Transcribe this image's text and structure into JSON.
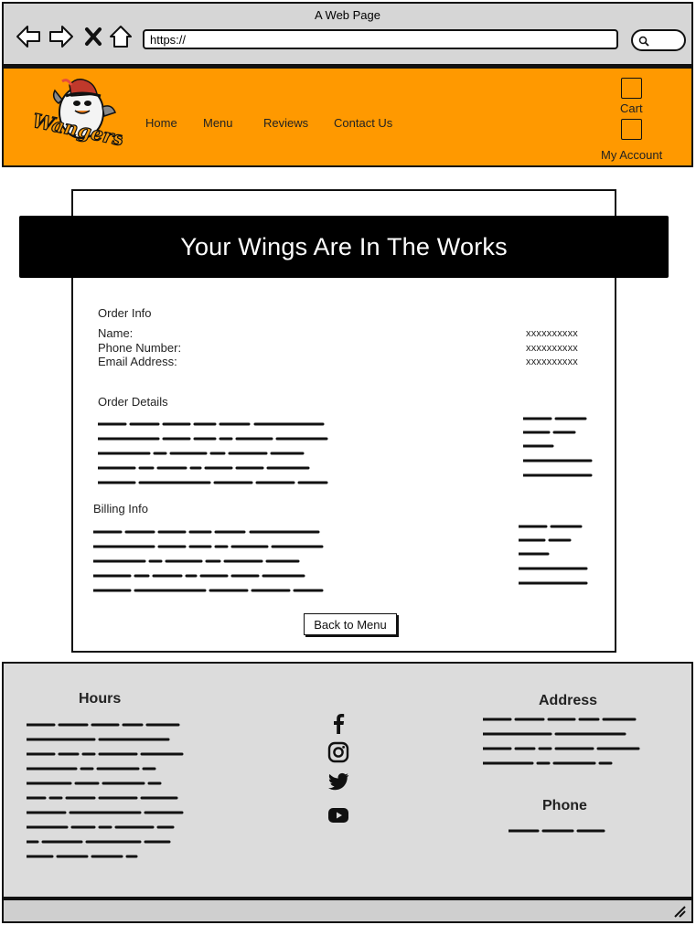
{
  "browser": {
    "title": "A Web Page",
    "url": "https://"
  },
  "header": {
    "logo_text": "Wangers",
    "nav": [
      "Home",
      "Menu",
      "Reviews",
      "Contact Us"
    ],
    "cart_label": "Cart",
    "account_label": "My Account",
    "brand_color": "#ff9900"
  },
  "main": {
    "banner": "Your Wings Are In The Works",
    "order_info": {
      "title": "Order Info",
      "rows": [
        {
          "label": "Name:",
          "value": "xxxxxxxxxx"
        },
        {
          "label": "Phone Number:",
          "value": "xxxxxxxxxx"
        },
        {
          "label": "Email Address:",
          "value": "xxxxxxxxxx"
        }
      ]
    },
    "order_details": {
      "title": "Order Details"
    },
    "billing_info": {
      "title": "Billing Info"
    },
    "back_button": "Back to Menu"
  },
  "footer": {
    "hours_title": "Hours",
    "address_title": "Address",
    "phone_title": "Phone",
    "social": [
      "facebook-icon",
      "instagram-icon",
      "twitter-icon",
      "youtube-icon"
    ]
  }
}
